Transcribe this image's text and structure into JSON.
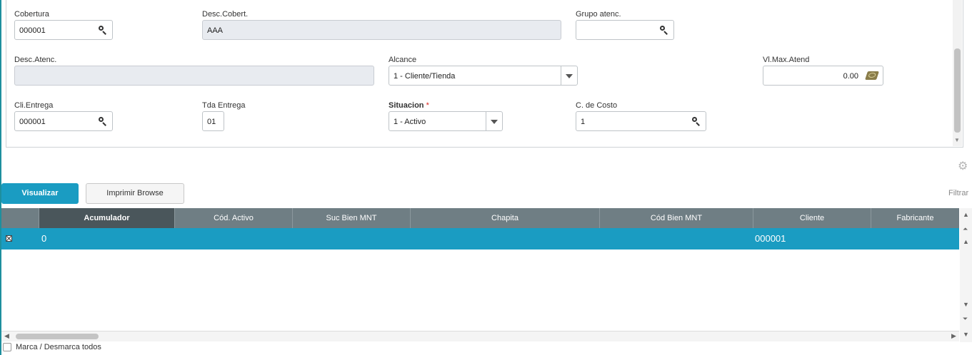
{
  "form": {
    "cobertura": {
      "label": "Cobertura",
      "value": "000001"
    },
    "desc_cobert": {
      "label": "Desc.Cobert.",
      "value": "AAA"
    },
    "grupo_atenc": {
      "label": "Grupo atenc.",
      "value": ""
    },
    "desc_atenc": {
      "label": "Desc.Atenc.",
      "value": ""
    },
    "alcance": {
      "label": "Alcance",
      "value": "1 - Cliente/Tienda"
    },
    "vl_max_atend": {
      "label": "Vl.Max.Atend",
      "value": "0.00"
    },
    "cli_entrega": {
      "label": "Cli.Entrega",
      "value": "000001"
    },
    "tda_entrega": {
      "label": "Tda Entrega",
      "value": "01"
    },
    "situacion": {
      "label": "Situacion",
      "required_mark": "*",
      "value": "1 - Activo"
    },
    "c_de_costo": {
      "label": "C. de Costo",
      "value": "1"
    }
  },
  "toolbar": {
    "visualizar_label": "Visualizar",
    "imprimir_label": "Imprimir Browse",
    "filtrar_label": "Filtrar"
  },
  "grid": {
    "columns": [
      "Acumulador",
      "Cód. Activo",
      "Suc Bien MNT",
      "Chapita",
      "Cód Bien MNT",
      "Cliente",
      "Fabricante"
    ],
    "rows": [
      {
        "acumulador": "0",
        "cod_activo": "",
        "suc_bien_mnt": "",
        "chapita": "",
        "cod_bien_mnt": "",
        "cliente": "000001",
        "fabricante": ""
      }
    ]
  },
  "footer": {
    "marca_label": "Marca / Desmarca todos"
  },
  "colors": {
    "accent": "#1a9cc2",
    "header": "#6f7e84",
    "selected_header": "#4a565b",
    "required": "#d9231d"
  },
  "icons": {
    "lookup": "search-icon",
    "dropdown": "chevron-down-icon",
    "calculator": "money-icon",
    "settings": "gear-icon"
  }
}
